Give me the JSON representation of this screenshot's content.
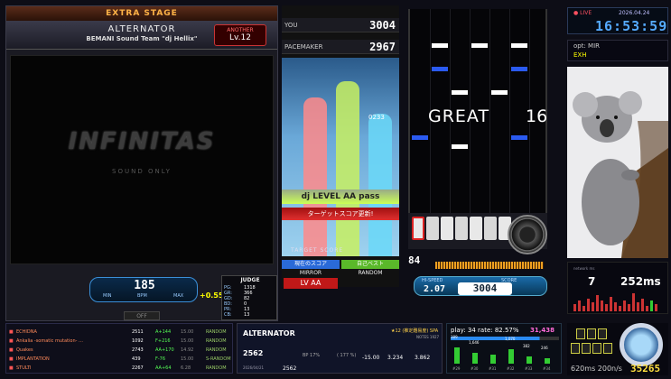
{
  "left": {
    "stage": "EXTRA STAGE",
    "title": "ALTERNATOR",
    "artist": "BEMANI Sound Team \"dj Hellix\"",
    "difficulty": "ANOTHER",
    "level": "Lv.12",
    "logo": "INFINITAS",
    "logo_sub": "SOUND ONLY",
    "bpm": "185",
    "bpm_min": "MIN",
    "bpm_mid": "BPM",
    "bpm_max": "MAX",
    "timing": "+0.55",
    "judge_title": "JUDGE",
    "judge": [
      {
        "k": "PG:",
        "v": "1318"
      },
      {
        "k": "GR:",
        "v": "366"
      },
      {
        "k": "GD:",
        "v": "82"
      },
      {
        "k": "BD:",
        "v": "0"
      },
      {
        "k": "PR:",
        "v": "13"
      },
      {
        "k": "CB:",
        "v": "13"
      }
    ],
    "fast_lbl": "FAST",
    "fast_val": "266",
    "slow_lbl": "SLOW",
    "slow_val": "182",
    "off": "OFF",
    "lane": "LANE"
  },
  "mid": {
    "you_lbl": "YOU",
    "you_score": "3004",
    "pm_lbl": "PACEMAKER",
    "pm_score": "2967",
    "graph_score": "0233",
    "dj_level": "dj LEVEL  AA  pass",
    "update": "ターゲットスコア更新!",
    "target": "TARGET SCORE",
    "cur_score": "現在のスコア",
    "best": "自己ベスト",
    "mirror": "MIRROR",
    "random": "RANDOM",
    "lv": "LV  AA",
    "bars": [
      {
        "color": "#ff8a8a",
        "value": 0.8
      },
      {
        "color": "#c8f060",
        "value": 0.88
      },
      {
        "color": "#6ad8f8",
        "value": 0.72
      }
    ]
  },
  "lanes": {
    "judgement": "GREAT",
    "combo": "16",
    "gauge": "84",
    "hs_lbl": "HI-SPEED",
    "sc_lbl": "SCORE",
    "hispeed": "2.07",
    "score": "3004"
  },
  "right": {
    "live": "● LIVE",
    "date": "2026.04.24",
    "clock": "16:53:59",
    "opt": "opt: MIR",
    "exh": "EXH",
    "lat_small": "network ms",
    "lat_count": "7",
    "lat_ms": "252ms"
  },
  "history": [
    {
      "label": "■",
      "song": "ECHIDNA",
      "score": "2511",
      "diff": "A+144",
      "rate": "15.00",
      "opt": "RANDOM"
    },
    {
      "label": "■",
      "song": "Ankalia -somatic mutation- …",
      "score": "1092",
      "diff": "F+216",
      "rate": "15.00",
      "opt": "RANDOM"
    },
    {
      "label": "■",
      "song": "Quakes",
      "score": "2743",
      "diff": "AA+170",
      "rate": "14.92",
      "opt": "RANDOM"
    },
    {
      "label": "■",
      "song": "IMPLANTATION",
      "score": "439",
      "diff": "F-76",
      "rate": "15.00",
      "opt": "S-RANDOM"
    },
    {
      "label": "■",
      "song": "STULTI",
      "score": "2267",
      "diff": "AA+64",
      "rate": "6.28",
      "opt": "RANDOM"
    }
  ],
  "card": {
    "title": "ALTERNATOR",
    "stars": "★12 (推定難易度) SPA",
    "notes": "NOTES 1927",
    "score": "2562",
    "bp": "BP 17%",
    "pct": "( 177 %)",
    "diff": "-15.00",
    "num1": "3.234",
    "num2": "3.862",
    "date": "2026/04/21",
    "score2": "2562"
  },
  "play": {
    "stat": "play: 34  rate: 82.57%",
    "total": "31,438",
    "cols": [
      {
        "lab": "#29",
        "cnt": "389",
        "h": 18
      },
      {
        "lab": "#30",
        "cnt": "1,646",
        "h": 12
      },
      {
        "lab": "#31",
        "cnt": "",
        "h": 10
      },
      {
        "lab": "#32",
        "cnt": "1,070",
        "h": 16
      },
      {
        "lab": "#33",
        "cnt": "382",
        "h": 8
      },
      {
        "lab": "#34",
        "cnt": "246",
        "h": 6
      }
    ]
  },
  "bottom_right": {
    "ms": "620ms  200n/s",
    "big": "35265"
  }
}
